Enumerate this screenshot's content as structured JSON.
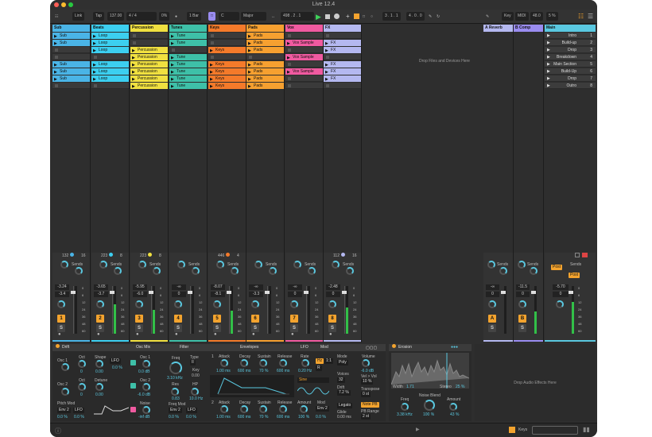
{
  "window_title": "Live 12.4",
  "control_bar": {
    "link": "Link",
    "tap": "Tap",
    "tempo": "137.00",
    "signature_num": "4",
    "signature_sep": "/",
    "signature_den": "4",
    "groove": "0%",
    "quantize": "1 Bar",
    "key": "C",
    "scale": "Major",
    "position": "498 . 2 . 1",
    "loop_start": "3 . 1 . 1",
    "loop_length": "4 . 0 . 0",
    "key_map": "Key",
    "midi_map": "MIDI",
    "sample_rate": "48.0",
    "cpu": "5 %"
  },
  "tracks": [
    {
      "name": "Sub",
      "color": "#4ab4e6",
      "clips": [
        "Sub",
        "Sub",
        "",
        "",
        "Sub",
        "Sub",
        "Sub"
      ],
      "slot_colors": [
        "#4ab4e6"
      ],
      "input": "132",
      "input2": "16",
      "num": "1",
      "vol": "-3.24",
      "vol2": "-3.4",
      "meter": 0.0,
      "solo": "S"
    },
    {
      "name": "Beats",
      "color": "#3ccff0",
      "clips": [
        "Loop",
        "Loop",
        "Loop",
        "",
        "Loop",
        "Loop",
        "Loop"
      ],
      "input": "223",
      "input2": "8",
      "num": "2",
      "vol": "-3.65",
      "vol2": "-3.7",
      "meter": 0.62,
      "solo": "S"
    },
    {
      "name": "Percussion",
      "color": "#f0e040",
      "clips": [
        "",
        "",
        "Percussion",
        "Percussion",
        "Percussion",
        "Percussion",
        "Percussion",
        "Percussion"
      ],
      "input": "223",
      "input2": "8",
      "num": "3",
      "vol": "-5.95",
      "vol2": "-6.0",
      "meter": 0.5,
      "solo": "S"
    },
    {
      "name": "Tunes",
      "color": "#3ec0a8",
      "clips": [
        "Tune",
        "Tune",
        "",
        "Tune",
        "Tune",
        "Tune",
        "Tune",
        "Tune"
      ],
      "input": "",
      "input2": "",
      "num": "4",
      "vol": "-∞",
      "vol2": "0",
      "meter": 0.0,
      "solo": "S"
    },
    {
      "name": "Keys",
      "color": "#f47a2a",
      "clips": [
        "",
        "",
        "Keys",
        "",
        "Keys",
        "Keys",
        "Keys",
        "Keys"
      ],
      "input": "446",
      "input2": "4",
      "num": "5",
      "vol": "-8.07",
      "vol2": "-8.1",
      "meter": 0.48,
      "solo": "S"
    },
    {
      "name": "Pads",
      "color": "#f6a030",
      "clips": [
        "Pads",
        "Pads",
        "Pads",
        "",
        "Pads",
        "Pads",
        "Pads",
        "Pads"
      ],
      "input": "",
      "input2": "",
      "num": "6",
      "vol": "-∞",
      "vol2": "-3.3",
      "meter": 0.0,
      "solo": "S"
    },
    {
      "name": "Vox",
      "color": "#f05aa0",
      "clips": [
        "",
        "Vox Sample",
        "",
        "Vox Sample",
        "",
        "Vox Sample",
        "",
        ""
      ],
      "input": "",
      "input2": "",
      "num": "7",
      "vol": "-∞",
      "vol2": "0",
      "meter": 0.0,
      "solo": "S"
    },
    {
      "name": "FX",
      "color": "#b4b8f0",
      "clips": [
        "",
        "FX",
        "FX",
        "",
        "FX",
        "FX",
        "FX",
        ""
      ],
      "input": "112",
      "input2": "16",
      "num": "8",
      "vol": "-2.48",
      "vol2": "0",
      "meter": 0.55,
      "solo": "S"
    }
  ],
  "drop_files_text": "Drop Files and Devices Here",
  "returns": [
    {
      "name": "A Reverb",
      "color": "#b4b8f0",
      "letter": "A",
      "vol": "-∞",
      "vol2": "0"
    },
    {
      "name": "B Comp",
      "color": "#9a8cf0",
      "letter": "B",
      "vol": "-11.5",
      "vol2": "0"
    }
  ],
  "main": {
    "name": "Main",
    "vol": "-5.70",
    "vol2": "0",
    "post_label": "Post",
    "post2": "Post"
  },
  "scenes": [
    {
      "name": "Intro",
      "num": "1"
    },
    {
      "name": "Build-up",
      "num": "2"
    },
    {
      "name": "Drop",
      "num": "3"
    },
    {
      "name": "Breakdown",
      "num": "4"
    },
    {
      "name": "Main Section",
      "num": "5"
    },
    {
      "name": "Build-Up",
      "num": "6"
    },
    {
      "name": "Drop",
      "num": "7"
    },
    {
      "name": "Outro",
      "num": "8"
    }
  ],
  "sends_label": "Sends",
  "db_scale": [
    "0",
    "6",
    "12",
    "24",
    "36",
    "48",
    "60"
  ],
  "drift": {
    "title": "Drift",
    "osc_mix": "Osc Mix",
    "filter": "Filter",
    "envelopes": "Envelopes",
    "lfo": "LFO",
    "mod": "Mod",
    "osc1": "Osc 1",
    "oct": "Oct",
    "oct1_val": "0",
    "shape": "Shape",
    "shape_val": "0.00",
    "lfo_sel": "LFO",
    "lfo_amt": "0.0 %",
    "osc1_level": "Osc 1",
    "osc1_db": "0.0 dB",
    "osc2": "Osc 2",
    "oct2_val": "0",
    "detune": "Detune",
    "detune_val": "0.00",
    "osc2_level": "Osc 2",
    "osc2_db": "-6.0 dB",
    "noise": "Noise",
    "noise_db": "-inf dB",
    "pitch_mod": "Pitch Mod",
    "env2": "Env 2",
    "lfo2": "LFO",
    "pm1": "0.0 %",
    "pm2": "0.0 %",
    "freq": "Freq",
    "freq_val": "3.10 kHz",
    "type": "Type",
    "type_val": "II",
    "key": "Key",
    "key_val": "0.00",
    "res": "Res",
    "res_val": "0.83",
    "hp": "HP",
    "hp_val": "10.0 Hz",
    "freq_mod": "Freq Mod",
    "fm_env": "Env 2",
    "fm_lfo": "LFO",
    "fm1": "0.0 %",
    "fm2": "0.0 %",
    "env1_no": "1",
    "env2_no": "2",
    "attack": "Attack",
    "decay": "Decay",
    "sustain": "Sustain",
    "release": "Release",
    "e1_attack": "1.00 ms",
    "e1_decay": "600 ms",
    "e1_sustain": "70 %",
    "e1_release": "600 ms",
    "e2_attack": "1.00 ms",
    "e2_decay": "600 ms",
    "e2_sustain": "70 %",
    "e2_release": "600 ms",
    "rate": "Rate",
    "rate_val": "0.20 Hz",
    "hz": "Hz",
    "ratio": "1:1",
    "sine": "Sine",
    "amount": "Amount",
    "amount_val": "100 %",
    "mod_label": "Mod",
    "mod_env": "Env 2",
    "mod_val": "0.0 %",
    "mode": "Mode",
    "mode_val": "Poly",
    "voices": "Voices",
    "voices_val": "32",
    "drift_lbl": "Drift",
    "drift_val": "7.2 %",
    "legato": "Legato",
    "glide": "Glide",
    "glide_val": "0.00 ms",
    "volume": "Volume",
    "volume_val": "-6.0 dB",
    "vel_vol": "Vel > Vol",
    "vel_val": "10 %",
    "transpose": "Transpose",
    "transpose_val": "0 st",
    "note_pb": "Note PB",
    "pb_range": "PB Range",
    "pb_val": "2 st"
  },
  "erosion": {
    "title": "Erosion",
    "width": "Width",
    "width_val": "1.71",
    "stereo": "Stereo",
    "stereo_val": "25 %",
    "freq": "Freq",
    "freq_val": "3.38 kHz",
    "noise_blend": "Noise Blend",
    "noise_blend_val": "100 %",
    "amount": "Amount",
    "amount_val": "43 %"
  },
  "drop_effects_text": "Drop Audio Effects Here",
  "status_bar": {
    "track": "Keys"
  }
}
